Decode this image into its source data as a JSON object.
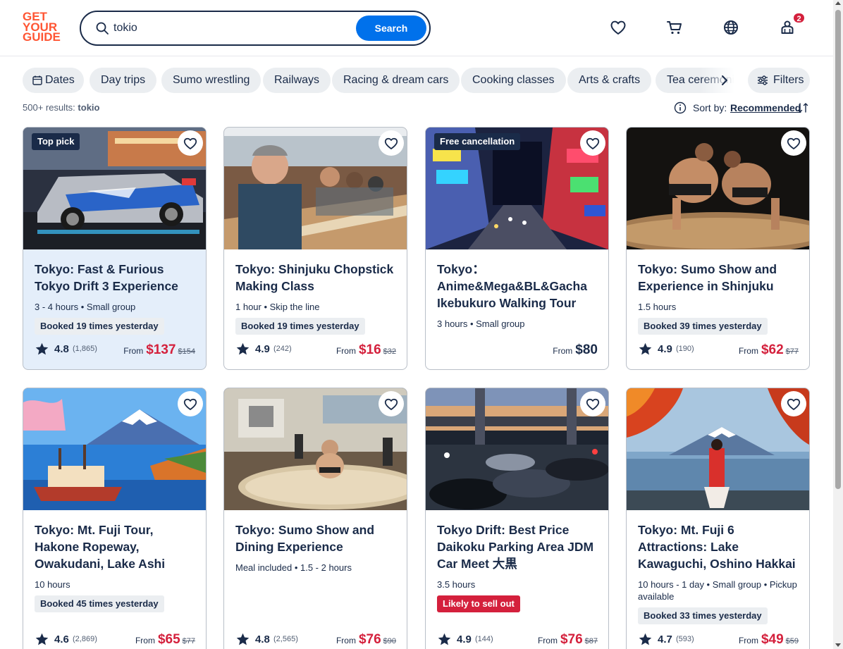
{
  "header": {
    "logo_lines": [
      "GET",
      "YOUR",
      "GUIDE"
    ],
    "search": {
      "value": "tokio",
      "button_label": "Search"
    },
    "cart_badge": "2"
  },
  "chips": [
    {
      "label": "Dates",
      "icon": "calendar-icon"
    },
    {
      "label": "Day trips"
    },
    {
      "label": "Sumo wrestling"
    },
    {
      "label": "Railways"
    },
    {
      "label": "Racing & dream cars"
    },
    {
      "label": "Cooking classes"
    },
    {
      "label": "Arts & crafts"
    },
    {
      "label": "Tea ceremonies"
    }
  ],
  "filters_label": "Filters",
  "results": {
    "count": "500+ results:",
    "query": "tokio"
  },
  "sort": {
    "label": "Sort by:",
    "value": "Recommended"
  },
  "colors": {
    "brand": "#ff5533",
    "primary_blue": "#0071eb",
    "price_red": "#d4203c",
    "navy": "#1a2b49"
  },
  "cards": [
    {
      "tag": "Top pick",
      "title": "Tokyo: Fast & Furious Tokyo Drift 3 Experience",
      "meta": "3 - 4 hours • Small group",
      "booked": "Booked 19 times yesterday",
      "rating": "4.8",
      "reviews": "(1,865)",
      "from": "From",
      "price": "$137",
      "old_price": "$154"
    },
    {
      "title": "Tokyo: Shinjuku Chopstick Making Class",
      "meta": "1 hour • Skip the line",
      "booked": "Booked 19 times yesterday",
      "rating": "4.9",
      "reviews": "(242)",
      "from": "From",
      "price": "$16",
      "old_price": "$32"
    },
    {
      "tag": "Free cancellation",
      "title": "Tokyo：Anime&Mega&BL&Gacha Ikebukuro Walking Tour",
      "meta": "3 hours • Small group",
      "from": "From",
      "price": "$80"
    },
    {
      "title": "Tokyo: Sumo Show and Experience in Shinjuku",
      "meta": "1.5 hours",
      "booked": "Booked 39 times yesterday",
      "rating": "4.9",
      "reviews": "(190)",
      "from": "From",
      "price": "$62",
      "old_price": "$77"
    },
    {
      "title": "Tokyo: Mt. Fuji Tour, Hakone Ropeway, Owakudani, Lake Ashi",
      "meta": "10 hours",
      "booked": "Booked 45 times yesterday",
      "rating": "4.6",
      "reviews": "(2,869)",
      "from": "From",
      "price": "$65",
      "old_price": "$77"
    },
    {
      "title": "Tokyo: Sumo Show and Dining Experience",
      "meta": "Meal included • 1.5 - 2 hours",
      "rating": "4.8",
      "reviews": "(2,565)",
      "from": "From",
      "price": "$76",
      "old_price": "$90"
    },
    {
      "title": "Tokyo Drift: Best Price Daikoku Parking Area JDM Car Meet 大黒",
      "meta": "3.5 hours",
      "sellout": "Likely to sell out",
      "rating": "4.9",
      "reviews": "(144)",
      "from": "From",
      "price": "$76",
      "old_price": "$87"
    },
    {
      "title": "Tokyo: Mt. Fuji 6 Attractions: Lake Kawaguchi, Oshino Hakkai",
      "meta": "10 hours - 1 day • Small group • Pickup available",
      "booked": "Booked 33 times yesterday",
      "rating": "4.7",
      "reviews": "(593)",
      "from": "From",
      "price": "$49",
      "old_price": "$59"
    }
  ]
}
